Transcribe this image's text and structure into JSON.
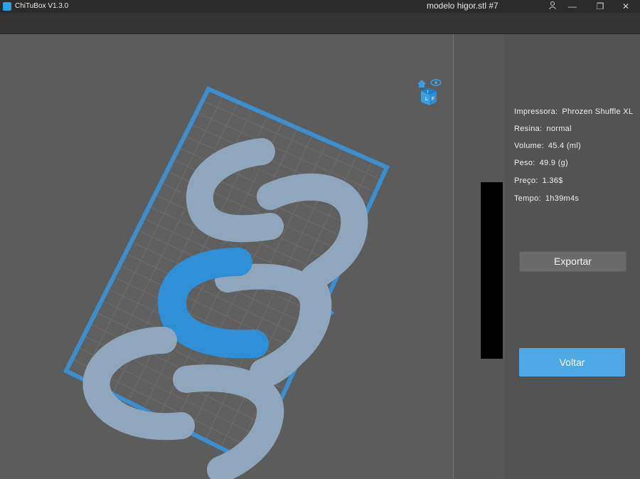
{
  "window": {
    "app_title": "ChiTuBox V1.3.0",
    "document_title": "modelo higor.stl #7",
    "controls": {
      "user": "user-icon",
      "minimize": "—",
      "restore": "❐",
      "close": "✕"
    }
  },
  "viewport": {
    "view_cube": {
      "home": "home-icon",
      "eye": "eye-icon",
      "faces": [
        "T",
        "L",
        "F"
      ]
    },
    "colors": {
      "background": "#5c5c5c",
      "plate_border": "#3b8fd0",
      "grid": "#6a6a6a",
      "model": "#8fa6bd",
      "selected_model": "#2f8fd6"
    }
  },
  "info_panel": {
    "rows": [
      {
        "label": "Impressora:",
        "value": "Phrozen Shuffle XL"
      },
      {
        "label": "Resina:",
        "value": "normal"
      },
      {
        "label": "Volume:",
        "value": "45.4  (ml)"
      },
      {
        "label": "Peso:",
        "value": "49.9  (g)"
      },
      {
        "label": "Preço:",
        "value": "1.36$"
      },
      {
        "label": "Tempo:",
        "value": "1h39m4s"
      }
    ],
    "export_label": "Exportar",
    "back_label": "Voltar"
  }
}
